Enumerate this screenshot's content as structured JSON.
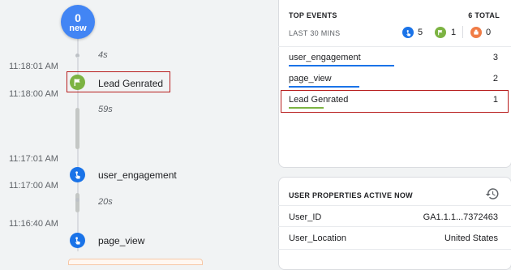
{
  "timeline": {
    "new_count": "0",
    "new_label": "new",
    "timestamps": [
      "11:18:01 AM",
      "11:18:00 AM",
      "11:17:01 AM",
      "11:17:00 AM",
      "11:16:40 AM"
    ],
    "gaps": [
      "4s",
      "59s",
      "20s"
    ],
    "events": [
      {
        "name": "Lead Genrated",
        "icon": "flag-icon",
        "color": "#7cb342",
        "highlighted": true
      },
      {
        "name": "user_engagement",
        "icon": "touch-icon",
        "color": "#1a73e8"
      },
      {
        "name": "page_view",
        "icon": "touch-icon",
        "color": "#1a73e8"
      }
    ]
  },
  "top_events": {
    "title": "TOP EVENTS",
    "total": "6 TOTAL",
    "subtitle": "LAST 30 MINS",
    "counts": [
      {
        "icon": "touch-icon",
        "color": "#1a73e8",
        "value": "5"
      },
      {
        "icon": "flag-icon",
        "color": "#7cb342",
        "value": "1"
      },
      {
        "icon": "alert-icon",
        "color": "#f07c46",
        "value": "0"
      }
    ],
    "rows": [
      {
        "name": "user_engagement",
        "value": "3",
        "bar_color": "#1a73e8",
        "fraction": 1.0
      },
      {
        "name": "page_view",
        "value": "2",
        "bar_color": "#1a73e8",
        "fraction": 0.67
      },
      {
        "name": "Lead Genrated",
        "value": "1",
        "bar_color": "#7cb342",
        "fraction": 0.33,
        "highlighted": true
      }
    ]
  },
  "user_properties": {
    "title": "USER PROPERTIES ACTIVE NOW",
    "icon": "history-icon",
    "rows": [
      {
        "name": "User_ID",
        "value": "GA1.1.1...7372463"
      },
      {
        "name": "User_Location",
        "value": "United States"
      }
    ]
  }
}
